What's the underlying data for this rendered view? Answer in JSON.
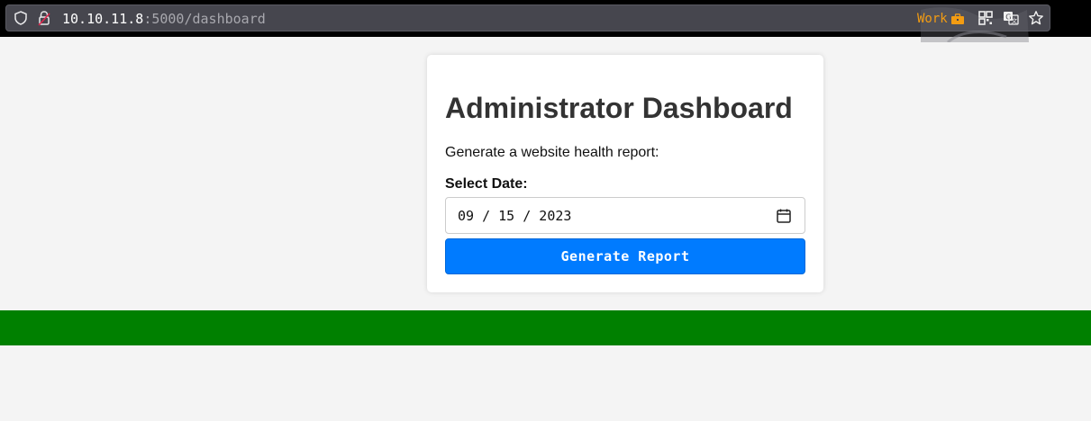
{
  "browser": {
    "url_host": "10.10.11.8",
    "url_path": ":5000/dashboard",
    "container_label": "Work",
    "icons": [
      "shield-icon",
      "lock-icon",
      "briefcase-icon",
      "qr-code-icon",
      "translate-icon",
      "star-icon"
    ],
    "colors": {
      "chrome_bg": "#000000",
      "urlbar_bg": "#46464e",
      "container": "#f39c12"
    }
  },
  "page": {
    "title": "Administrator Dashboard",
    "description": "Generate a website health report:",
    "date_label": "Select Date:",
    "date_value": "09 / 15 / 2023",
    "date_icon": "calendar-icon",
    "button_label": "Generate Report",
    "colors": {
      "background": "#f4f4f4",
      "button": "#007bff",
      "footer_bar": "#008000"
    }
  }
}
